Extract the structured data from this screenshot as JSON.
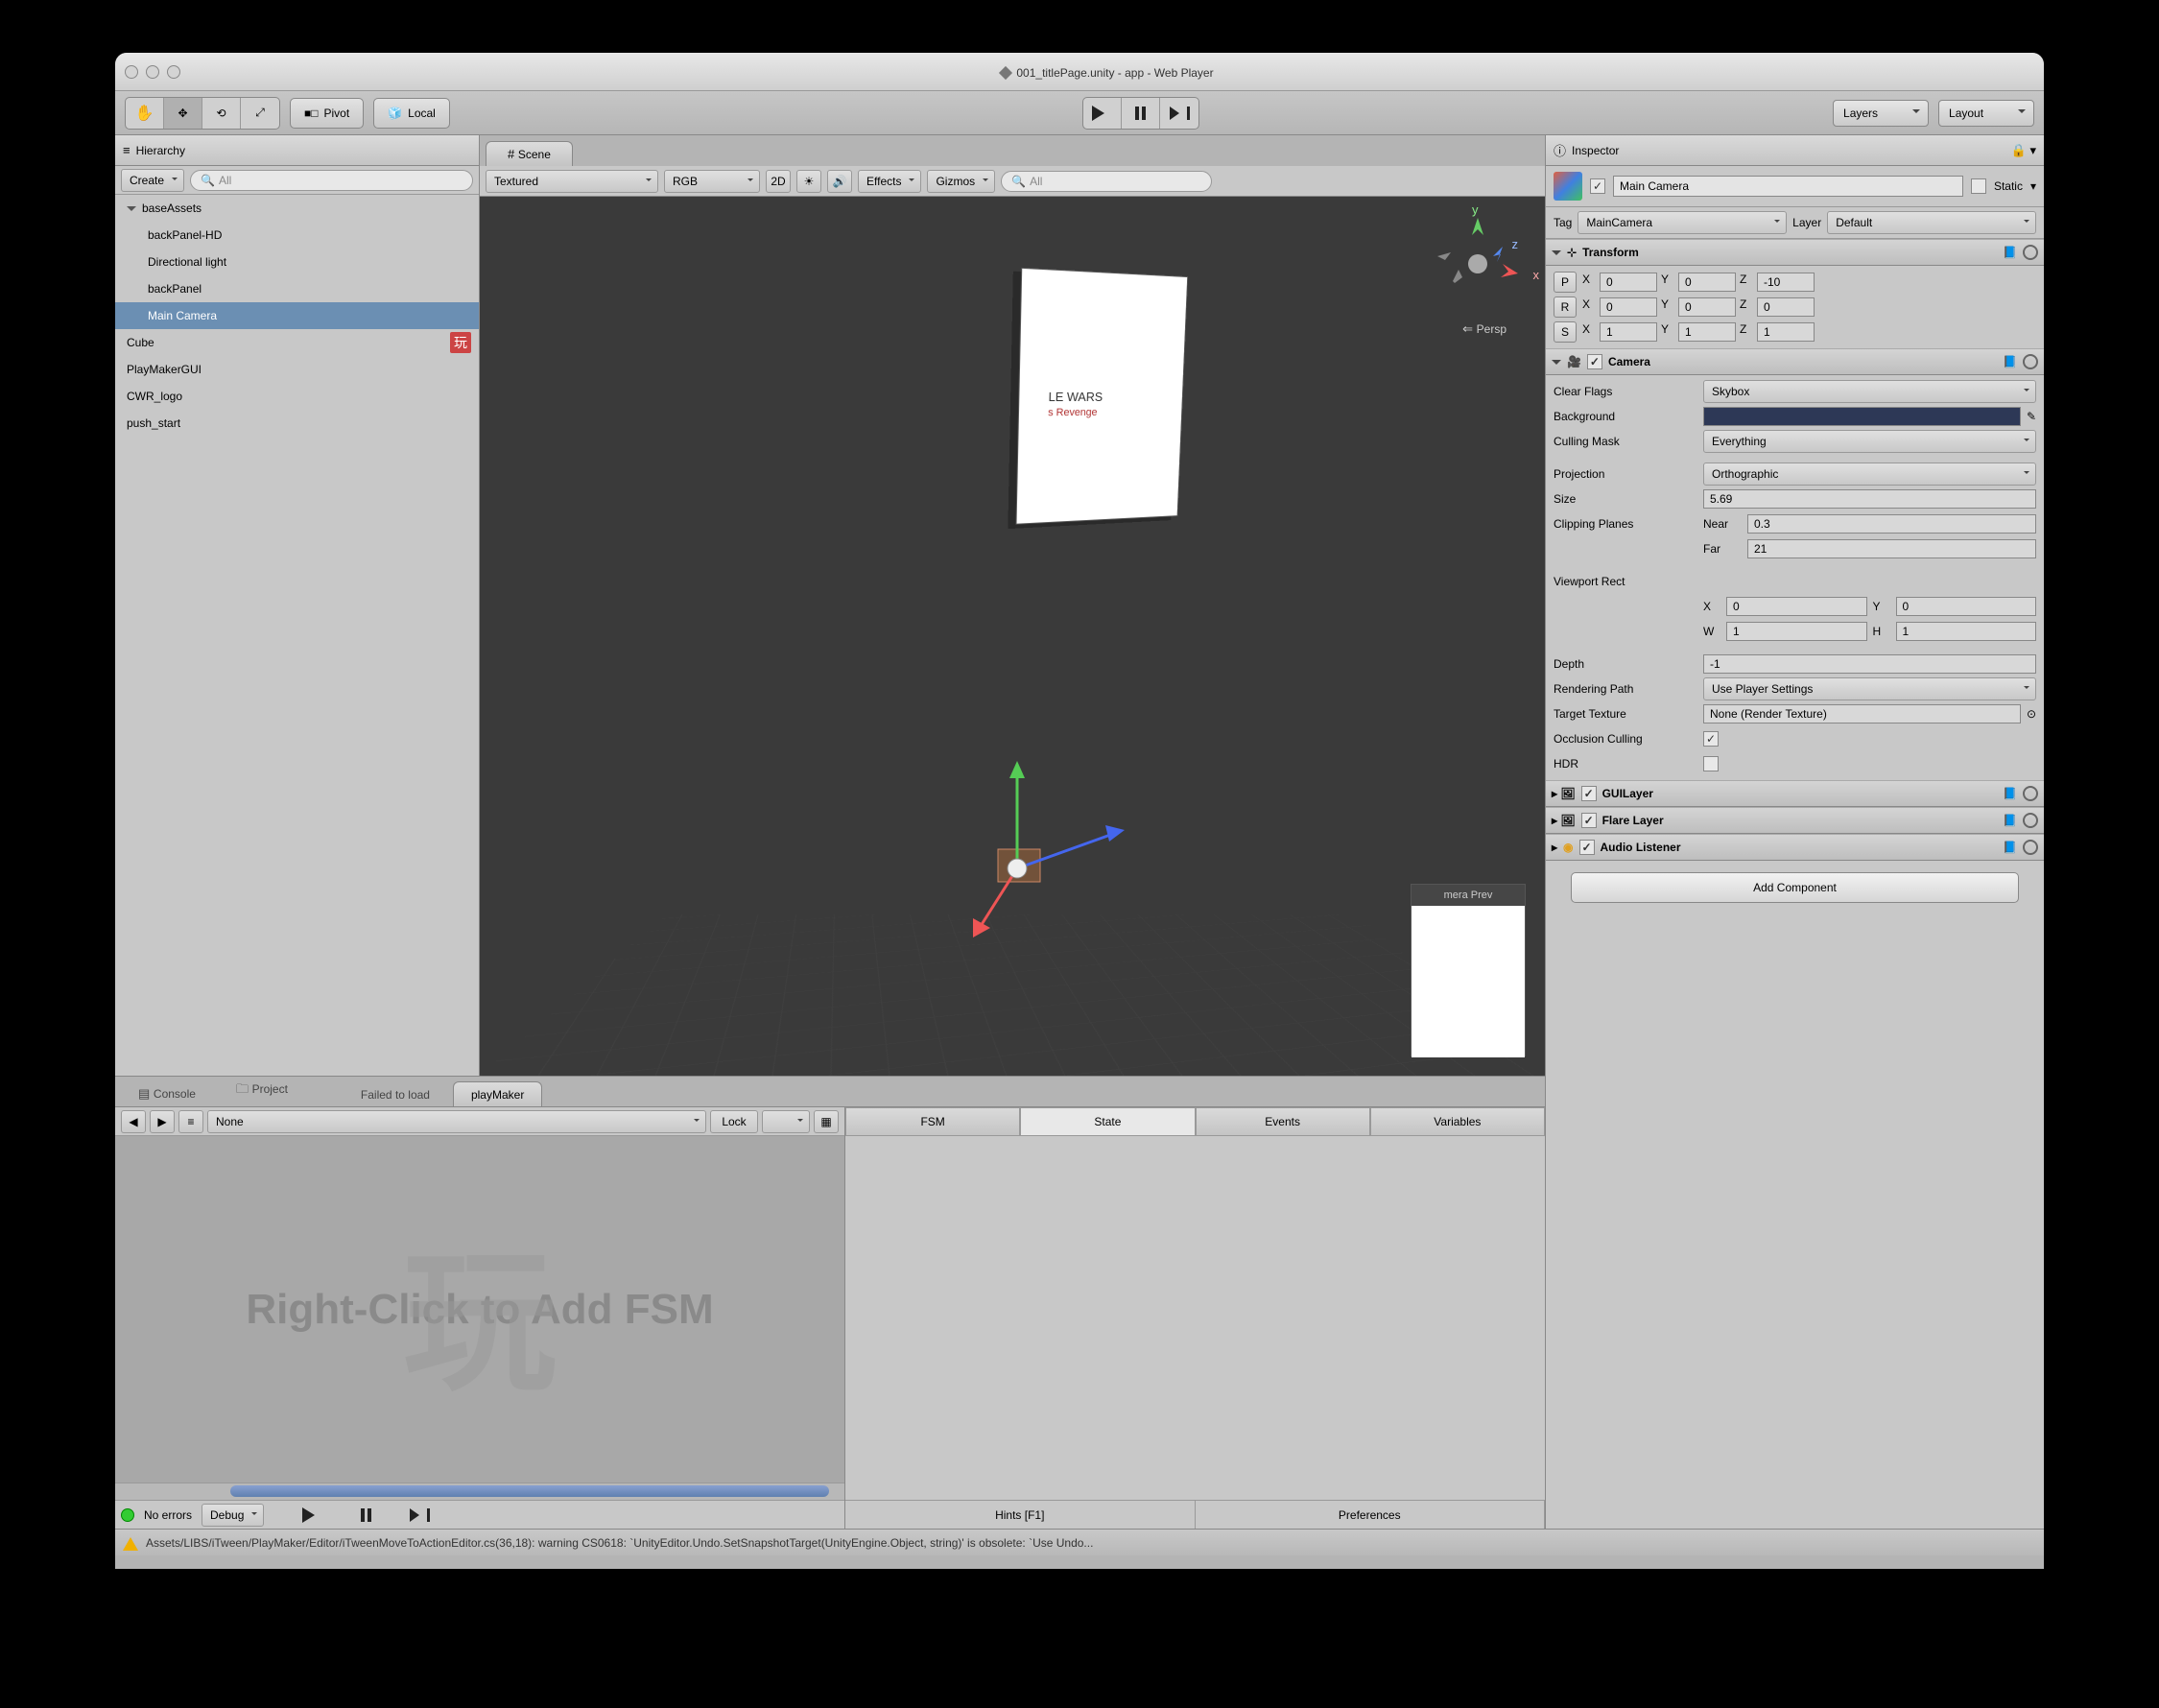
{
  "window": {
    "title": "001_titlePage.unity - app - Web Player"
  },
  "toolbar": {
    "pivot": "Pivot",
    "local": "Local",
    "layers": "Layers",
    "layout": "Layout"
  },
  "hierarchy": {
    "title": "Hierarchy",
    "create": "Create",
    "search_placeholder": "All",
    "items": [
      {
        "name": "baseAssets",
        "children": [
          "backPanel-HD",
          "Directional light",
          "backPanel",
          "Main Camera"
        ]
      },
      {
        "name": "Cube"
      },
      {
        "name": "PlayMakerGUI"
      },
      {
        "name": "CWR_logo"
      },
      {
        "name": "push_start"
      }
    ],
    "selected": "Main Camera"
  },
  "scene": {
    "tab": "Scene",
    "shading": "Textured",
    "render": "RGB",
    "twod": "2D",
    "effects": "Effects",
    "gizmos": "Gizmos",
    "search_placeholder": "All",
    "gizmo": {
      "x": "x",
      "y": "y",
      "z": "z",
      "persp": "Persp"
    },
    "preview_label": "mera Prev",
    "panel_text1": "LE WARS",
    "panel_text2": "s Revenge"
  },
  "bottom": {
    "tabs": [
      "Console",
      "Project",
      "Failed to load",
      "playMaker"
    ],
    "active": "playMaker"
  },
  "playmaker": {
    "none": "None",
    "lock": "Lock",
    "hint": "Right-Click to Add FSM",
    "no_errors": "No errors",
    "debug": "Debug",
    "tabs": [
      "FSM",
      "State",
      "Events",
      "Variables"
    ],
    "active_tab": "State",
    "hints": "Hints [F1]",
    "prefs": "Preferences"
  },
  "inspector": {
    "title": "Inspector",
    "obj_name": "Main Camera",
    "static": "Static",
    "tag_label": "Tag",
    "tag": "MainCamera",
    "layer_label": "Layer",
    "layer": "Default",
    "transform": {
      "title": "Transform",
      "p": "P",
      "r": "R",
      "s": "S",
      "px": "0",
      "py": "0",
      "pz": "-10",
      "rx": "0",
      "ry": "0",
      "rz": "0",
      "sx": "1",
      "sy": "1",
      "sz": "1",
      "X": "X",
      "Y": "Y",
      "Z": "Z"
    },
    "camera": {
      "title": "Camera",
      "clear_flags_label": "Clear Flags",
      "clear_flags": "Skybox",
      "background_label": "Background",
      "culling_label": "Culling Mask",
      "culling": "Everything",
      "projection_label": "Projection",
      "projection": "Orthographic",
      "size_label": "Size",
      "size": "5.69",
      "clip_label": "Clipping Planes",
      "near_label": "Near",
      "near": "0.3",
      "far_label": "Far",
      "far": "21",
      "viewport_label": "Viewport Rect",
      "vx_label": "X",
      "vx": "0",
      "vy_label": "Y",
      "vy": "0",
      "vw_label": "W",
      "vw": "1",
      "vh_label": "H",
      "vh": "1",
      "depth_label": "Depth",
      "depth": "-1",
      "renderpath_label": "Rendering Path",
      "renderpath": "Use Player Settings",
      "target_label": "Target Texture",
      "target": "None (Render Texture)",
      "occlusion_label": "Occlusion Culling",
      "hdr_label": "HDR"
    },
    "guilayer": "GUILayer",
    "flarelayer": "Flare Layer",
    "audiolistener": "Audio Listener",
    "add_component": "Add Component"
  },
  "status": {
    "message": "Assets/LIBS/iTween/PlayMaker/Editor/iTweenMoveToActionEditor.cs(36,18): warning CS0618: `UnityEditor.Undo.SetSnapshotTarget(UnityEngine.Object, string)' is obsolete: `Use Undo..."
  }
}
